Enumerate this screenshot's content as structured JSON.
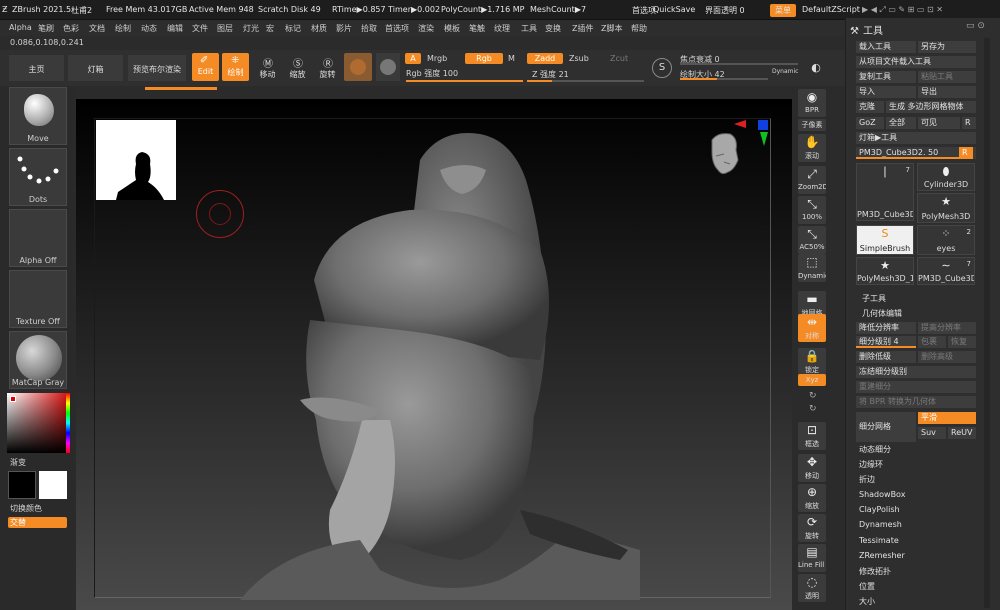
{
  "titlebar": {
    "app": "ZBrush 2021.5",
    "doc": "杜甫2",
    "free_mem": "Free Mem 43.017GB",
    "active_mem": "Active Mem 948",
    "scratch": "Scratch Disk 49",
    "rtime": "RTime▶0.857 Timer▶0.002",
    "polycount": "PolyCount▶1.716 MP",
    "meshcount": "MeshCount▶7",
    "menus_label": "首选项",
    "quicksave": "QuickSave",
    "transparency": "界面透明 0",
    "menu_btn": "菜单",
    "script": "DefaultZScript"
  },
  "menubar": [
    "Alpha",
    "笔刷",
    "色彩",
    "文档",
    "绘制",
    "动态",
    "编辑",
    "文件",
    "图层",
    "灯光",
    "宏",
    "标记",
    "材质",
    "影片",
    "拾取",
    "首选项",
    "渲染",
    "模板",
    "笔触",
    "纹理",
    "工具",
    "变换",
    "Z插件",
    "Z脚本",
    "帮助"
  ],
  "coords": "0.086,0.108,0.241",
  "toolbar": {
    "home": "主页",
    "lightbox": "灯箱",
    "bpr": "预览布尔渲染",
    "edit": "Edit",
    "draw": "绘制",
    "move": "移动",
    "scale": "缩放",
    "rotate": "旋转",
    "A": "A",
    "mrgb": "Mrgb",
    "rgb": "Rgb",
    "M": "M",
    "zadd": "Zadd",
    "zsub": "Zsub",
    "zcut": "Zcut",
    "rgb_intensity": "Rgb 强度 100",
    "z_intensity": "Z 强度 21",
    "focal": "焦点衰减 0",
    "draw_size": "绘制大小 42",
    "dynamic": "Dynamic",
    "rgb_intensity_value": 1.0,
    "z_intensity_value": 0.21,
    "draw_size_value": 0.42
  },
  "left": {
    "move": "Move",
    "dots": "Dots",
    "alpha": "Alpha Off",
    "texture": "Texture Off",
    "matcap": "MatCap Gray",
    "gradient": "渐变",
    "switch": "切换颜色",
    "alternate": "交替"
  },
  "right_shelf": [
    "BPR",
    "子像素",
    "滚动",
    "Zoom2D",
    "100%",
    "AC50%",
    "Dynamic 透视",
    "地网格",
    "对称",
    "锁定",
    "Xyz",
    "",
    "",
    "框选",
    "移动",
    "缩放",
    "旋转",
    "Line Fill PolyF",
    "透明"
  ],
  "panel": {
    "title": "工具",
    "load": "载入工具",
    "saveas": "另存为",
    "from_project": "从项目文件载入工具",
    "copy": "复制工具",
    "paste": "粘贴工具",
    "import": "导入",
    "export": "导出",
    "clone": "克隆",
    "make_poly": "生成 多边形网格物体",
    "goz": "GoZ",
    "all": "全部",
    "visible": "可见",
    "r": "R",
    "lightbox_tools": "灯箱▶工具",
    "current": "PM3D_Cube3D2. 50",
    "tools": [
      {
        "name": "PM3D_Cube3D2",
        "num": "7"
      },
      {
        "name": "Cylinder3D",
        "num": ""
      },
      {
        "name": "PolyMesh3D",
        "num": ""
      },
      {
        "name": "SimpleBrush",
        "num": ""
      },
      {
        "name": "eyes",
        "num": "2"
      },
      {
        "name": "PolyMesh3D_1",
        "num": ""
      },
      {
        "name": "PM3D_Cube3D2",
        "num": "7"
      }
    ],
    "subtool": "子工具",
    "geometry": "几何体编辑",
    "lower": "降低分辨率",
    "higher": "提高分辨率",
    "sdiv": "细分级别 4",
    "cage": "包裹",
    "rstr": "恢复",
    "del_lower": "删除低级",
    "del_higher": "删除高级",
    "freeze": "冻结细分级别",
    "reconstruct": "重建细分",
    "bpr_geo": "将 BPR 转换为几何体",
    "divide": "细分网格",
    "smooth": "平滑",
    "suv": "Suv",
    "reuv": "ReUV",
    "dynamesh_sub": "动态细分",
    "edgeloop": "边缘环",
    "crease": "折边",
    "shadowbox": "ShadowBox",
    "claypolish": "ClayPolish",
    "dynamesh": "Dynamesh",
    "tessimate": "Tessimate",
    "zremesher": "ZRemesher",
    "modify": "修改拓扑",
    "position": "位置",
    "size": "大小"
  }
}
